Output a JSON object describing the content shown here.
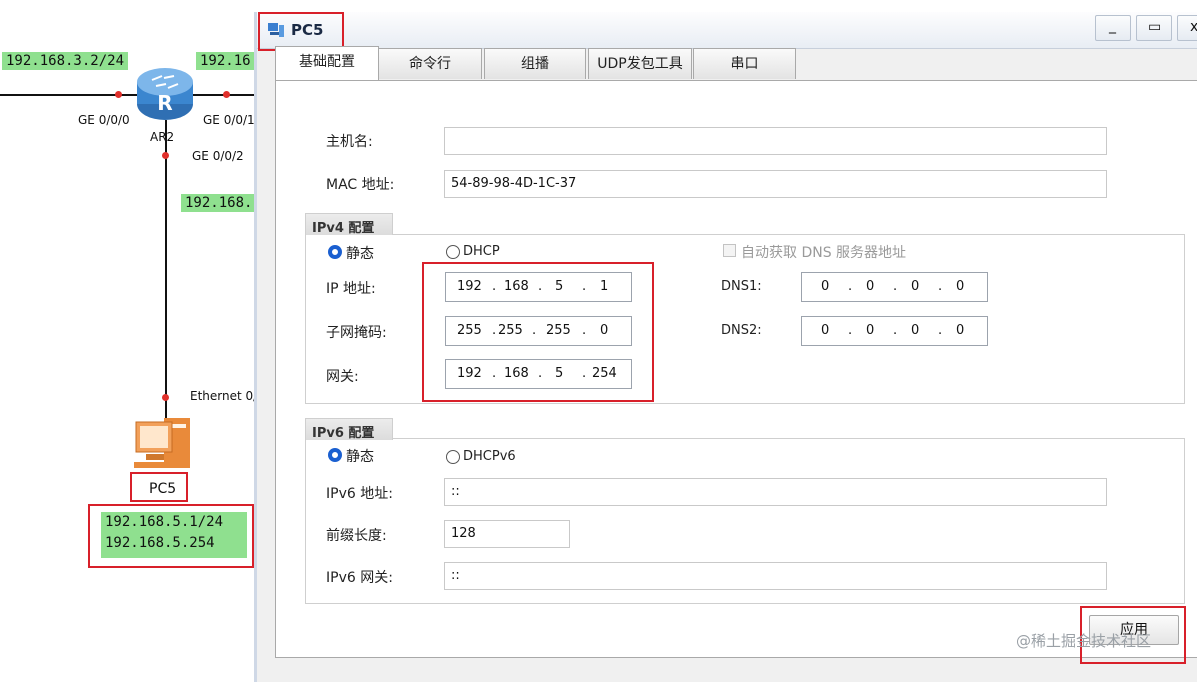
{
  "topology": {
    "labels": {
      "ar2_left_ip": "192.168.3.2/24",
      "ar2_right_ip_partial": "192.16",
      "ar2_down_ip_partial": "192.168.",
      "pc5_ip": "192.168.5.1/24",
      "pc5_gateway": "192.168.5.254"
    },
    "router": {
      "name": "AR2",
      "port_left": "GE 0/0/0",
      "port_right": "GE 0/0/1",
      "port_down": "GE 0/0/2"
    },
    "pc": {
      "name": "PC5",
      "port": "Ethernet 0/"
    }
  },
  "window": {
    "title": "PC5",
    "controls": {
      "minimize": "_",
      "maximize": "▭",
      "close": "x"
    },
    "tabs": [
      {
        "label": "基础配置",
        "active": true
      },
      {
        "label": "命令行",
        "active": false
      },
      {
        "label": "组播",
        "active": false
      },
      {
        "label": "UDP发包工具",
        "active": false
      },
      {
        "label": "串口",
        "active": false
      }
    ],
    "basic": {
      "hostname_label": "主机名:",
      "hostname_value": "",
      "mac_label": "MAC 地址:",
      "mac_value": "54-89-98-4D-1C-37"
    },
    "ipv4": {
      "title": "IPv4 配置",
      "static_label": "静态",
      "dhcp_label": "DHCP",
      "auto_dns_label": "自动获取 DNS 服务器地址",
      "ip_label": "IP 地址:",
      "ip": [
        "192",
        "168",
        "5",
        "1"
      ],
      "mask_label": "子网掩码:",
      "mask": [
        "255",
        "255",
        "255",
        "0"
      ],
      "gateway_label": "网关:",
      "gateway": [
        "192",
        "168",
        "5",
        "254"
      ],
      "dns1_label": "DNS1:",
      "dns1": [
        "0",
        "0",
        "0",
        "0"
      ],
      "dns2_label": "DNS2:",
      "dns2": [
        "0",
        "0",
        "0",
        "0"
      ]
    },
    "ipv6": {
      "title": "IPv6 配置",
      "static_label": "静态",
      "dhcp_label": "DHCPv6",
      "addr_label": "IPv6 地址:",
      "addr_value": "::",
      "prefix_label": "前缀长度:",
      "prefix_value": "128",
      "gateway_label": "IPv6 网关:",
      "gateway_value": "::"
    },
    "apply_label": "应用"
  },
  "watermark": "@稀土掘金技术社区",
  "colors": {
    "highlight_red": "#d8202a",
    "label_green": "#8fe08f",
    "radio_blue": "#1a5fd0"
  }
}
